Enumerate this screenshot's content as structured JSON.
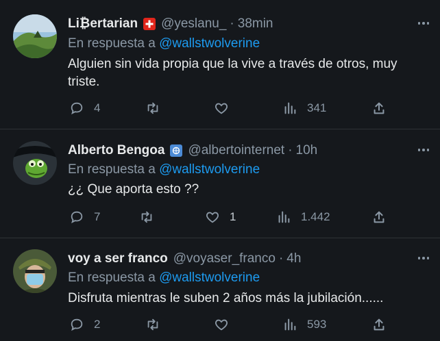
{
  "tweets": [
    {
      "name": "Li₿ertarian",
      "badge_color": "#e1251b",
      "handle": "@yeslanu_",
      "time": "38min",
      "reply_prefix": "En respuesta a",
      "reply_to": "@wallstwolverine",
      "text": "Alguien sin vida propia que la vive a través de otros, muy triste.",
      "replies": "4",
      "retweets": "",
      "likes": "",
      "views": "341"
    },
    {
      "name": "Alberto Bengoa",
      "badge_color": "#4c8bd6",
      "handle": "@albertointernet",
      "time": "10h",
      "reply_prefix": "En respuesta a",
      "reply_to": "@wallstwolverine",
      "text": "¿¿ Que aporta esto ??",
      "replies": "7",
      "retweets": "",
      "likes": "1",
      "views": "1.442"
    },
    {
      "name": "voy a ser franco",
      "handle": "@voyaser_franco",
      "time": "4h",
      "reply_prefix": "En respuesta a",
      "reply_to": "@wallstwolverine",
      "text": "Disfruta mientras le suben 2 años más la jubilación......",
      "replies": "2",
      "retweets": "",
      "likes": "",
      "views": "593"
    }
  ],
  "separator": "·",
  "colors": {
    "background": "#15181c",
    "link": "#1d9bf0",
    "muted": "#8b98a5",
    "divider": "#2f3336"
  },
  "icons": [
    "reply-icon",
    "retweet-icon",
    "like-icon",
    "views-icon",
    "share-icon",
    "more-icon"
  ]
}
